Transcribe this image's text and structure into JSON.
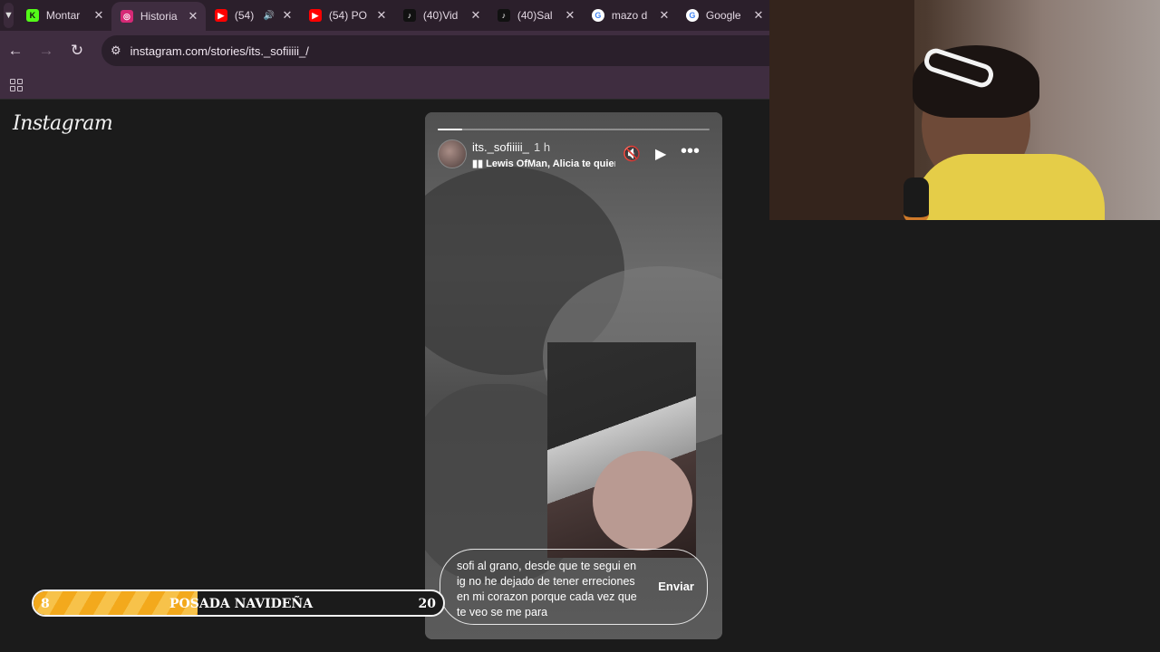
{
  "browser": {
    "tabs": [
      {
        "title": "Montar",
        "favicon": "kick-icon",
        "color": "#53fc18",
        "active": false
      },
      {
        "title": "Historia",
        "favicon": "instagram-icon",
        "color": "#d62976",
        "active": true
      },
      {
        "title": "(54)",
        "favicon": "youtube-icon",
        "color": "#ff0000",
        "active": false,
        "audio": true
      },
      {
        "title": "(54) PO",
        "favicon": "youtube-icon",
        "color": "#ff0000",
        "active": false
      },
      {
        "title": "(40)Vid",
        "favicon": "tiktok-icon",
        "color": "#111111",
        "active": false
      },
      {
        "title": "(40)Sal",
        "favicon": "tiktok-icon",
        "color": "#111111",
        "active": false
      },
      {
        "title": "mazo d",
        "favicon": "google-icon",
        "color": "#ffffff",
        "active": false
      },
      {
        "title": "Google",
        "favicon": "google-icon",
        "color": "#ffffff",
        "active": false
      }
    ],
    "url": "instagram.com/stories/its._sofiiiii_/"
  },
  "page": {
    "logo": "Instagram"
  },
  "story": {
    "username": "its._sofiiiii_",
    "time": "1 h",
    "music": "Lewis OfMan, Alicia te quiero",
    "progress": 0.09,
    "reply_text": "sofi al grano, desde que te segui en ig no he dejado de tener erreciones en mi corazon porque cada vez que te veo se me para",
    "send_label": "Enviar"
  },
  "overlay": {
    "left_number": "8",
    "label": "POSADA NAVIDEÑA",
    "right_number": "20",
    "progress": 0.4
  }
}
